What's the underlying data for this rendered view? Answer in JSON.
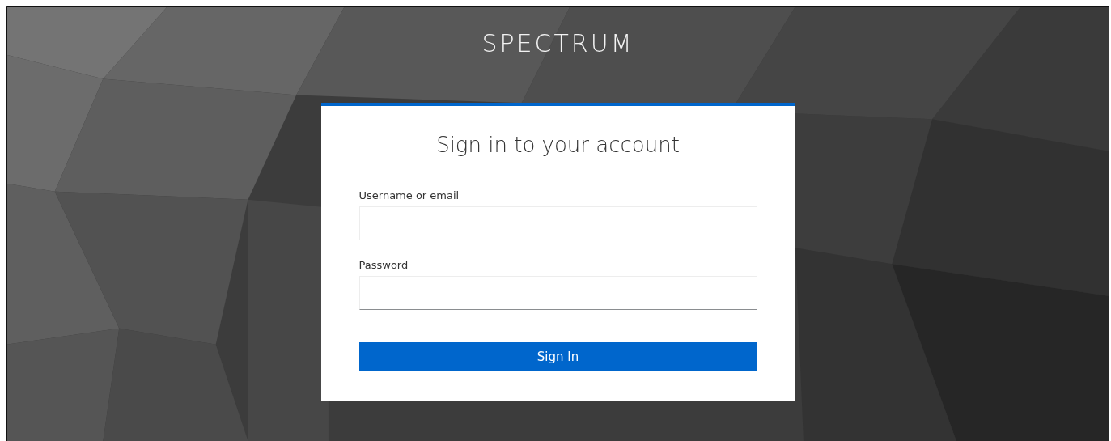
{
  "brand": "SPECTRUM",
  "login": {
    "title": "Sign in to your account",
    "fields": [
      {
        "label": "Username or email"
      },
      {
        "label": "Password"
      }
    ],
    "submit": "Sign In"
  }
}
